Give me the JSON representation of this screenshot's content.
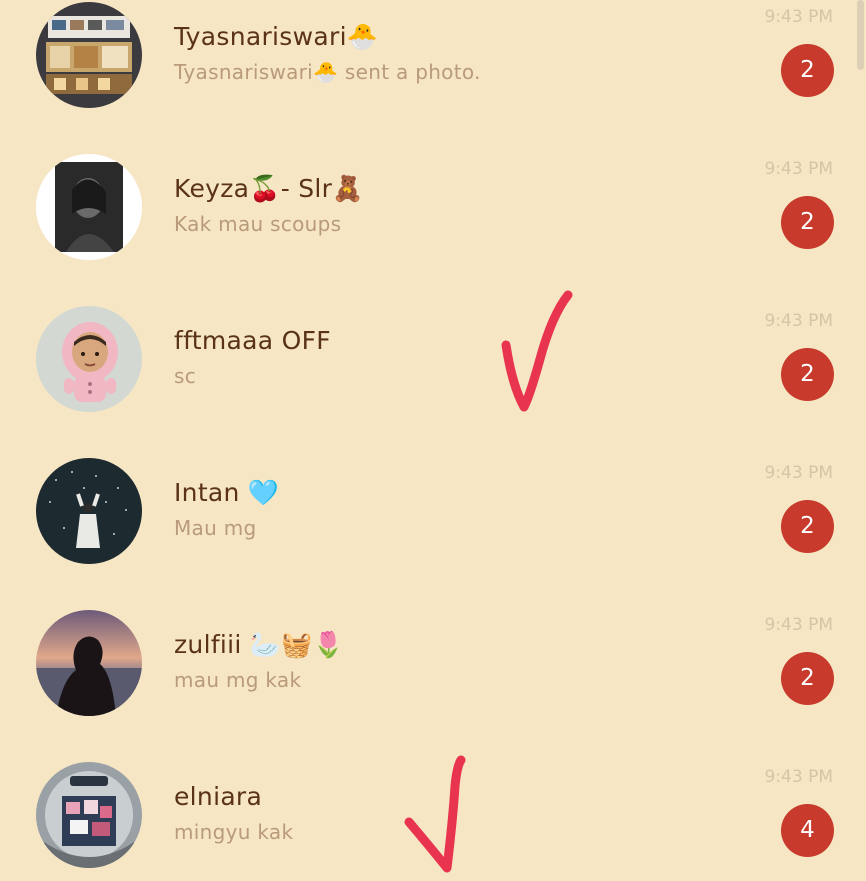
{
  "colors": {
    "background": "#f6e6c4",
    "name": "#5a3316",
    "preview": "#b99a79",
    "time": "#d8c3a6",
    "badge": "#c83a2b",
    "checkmark": "#e8344f"
  },
  "chats": [
    {
      "name": "Tyasnariswari🐣",
      "preview": "Tyasnariswari🐣 sent a photo.",
      "time": "9:43 PM",
      "unread": "2",
      "avatar": "shop-display-photo"
    },
    {
      "name": "Keyza🍒- Slr🧸",
      "preview": "Kak mau scoups",
      "time": "9:43 PM",
      "unread": "2",
      "avatar": "grayscale-selfie-photo"
    },
    {
      "name": "fftmaaa OFF",
      "preview": "sc",
      "time": "9:43 PM",
      "unread": "2",
      "avatar": "pink-raincoat-cartoon"
    },
    {
      "name": "Intan 🩵",
      "preview": "Mau mg",
      "time": "9:43 PM",
      "unread": "2",
      "avatar": "night-sky-figure-photo"
    },
    {
      "name": "zulfiii 🦢🧺🌷",
      "preview": "mau mg kak",
      "time": "9:43 PM",
      "unread": "2",
      "avatar": "sunset-silhouette-photo"
    },
    {
      "name": "elniara",
      "preview": "mingyu kak",
      "time": "9:43 PM",
      "unread": "4",
      "avatar": "mirror-booth-photo"
    }
  ]
}
